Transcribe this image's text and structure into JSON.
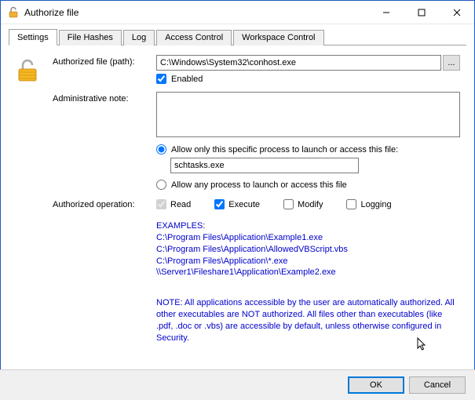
{
  "title": "Authorize file",
  "tabs": {
    "t0": "Settings",
    "t1": "File Hashes",
    "t2": "Log",
    "t3": "Access Control",
    "t4": "Workspace Control"
  },
  "labels": {
    "path": "Authorized file (path):",
    "enabled": "Enabled",
    "note": "Administrative note:",
    "radio_specific": "Allow only this specific process to launch or access this file:",
    "radio_any": "Allow any process to launch or access this file",
    "ops": "Authorized operation:",
    "op_read": "Read",
    "op_exec": "Execute",
    "op_mod": "Modify",
    "op_log": "Logging"
  },
  "values": {
    "path": "C:\\Windows\\System32\\conhost.exe",
    "process": "schtasks.exe",
    "admin_note": ""
  },
  "examples": {
    "hdr": "EXAMPLES:",
    "l1": "C:\\Program Files\\Application\\Example1.exe",
    "l2": "C:\\Program Files\\Application\\AllowedVBScript.vbs",
    "l3": "C:\\Program Files\\Application\\*.exe",
    "l4": "\\\\Server1\\Fileshare1\\Application\\Example2.exe"
  },
  "note_text": "NOTE: All applications accessible by the user are automatically authorized. All other executables are NOT authorized. All files other than executables (like .pdf, .doc or .vbs) are accessible by default, unless otherwise configured in Security.",
  "buttons": {
    "ok": "OK",
    "cancel": "Cancel",
    "browse": "..."
  }
}
